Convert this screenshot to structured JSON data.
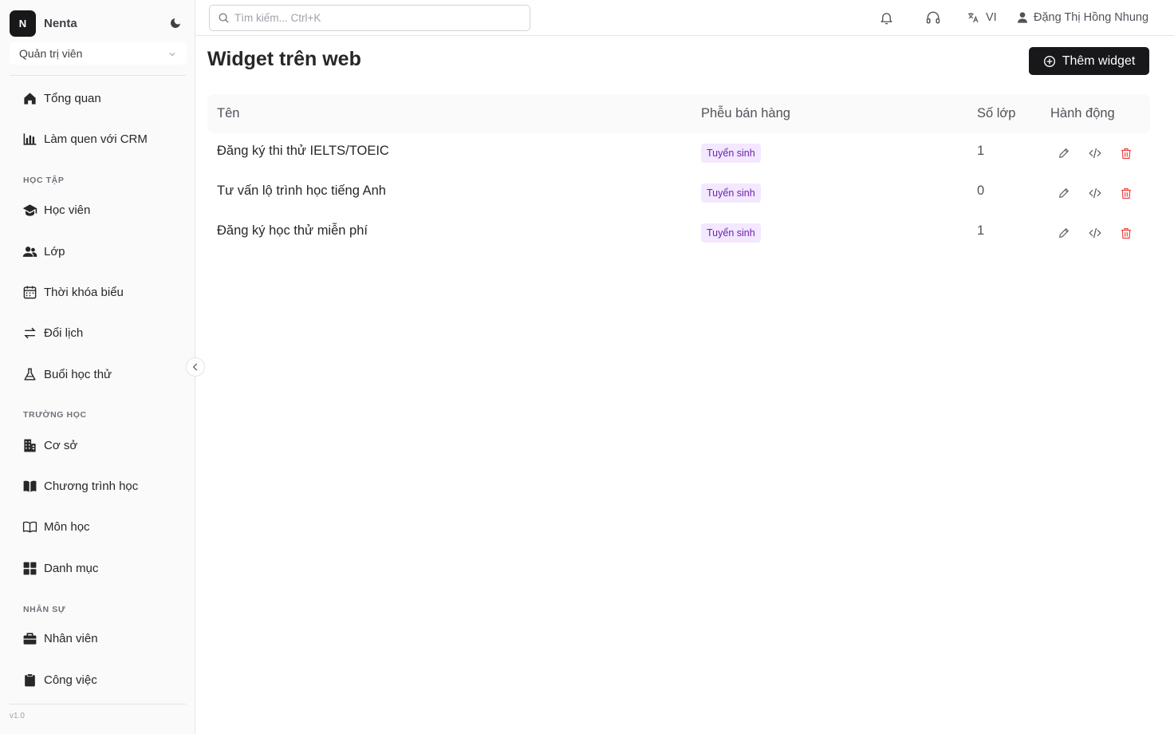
{
  "app": {
    "logo_letter": "N",
    "name": "Nenta"
  },
  "role": {
    "selected": "Quản trị viên"
  },
  "sidebar": {
    "items_top": [
      {
        "label": "Tổng quan",
        "icon": "home-icon"
      },
      {
        "label": "Làm quen với CRM",
        "icon": "bar-chart-icon"
      }
    ],
    "sections": [
      {
        "title": "HỌC TẬP",
        "items": [
          {
            "label": "Học viên",
            "icon": "graduation-cap-icon"
          },
          {
            "label": "Lớp",
            "icon": "users-icon"
          },
          {
            "label": "Thời khóa biểu",
            "icon": "calendar-icon"
          },
          {
            "label": "Đổi lịch",
            "icon": "swap-arrows-icon"
          },
          {
            "label": "Buổi học thử",
            "icon": "flask-icon"
          }
        ]
      },
      {
        "title": "TRƯỜNG HỌC",
        "items": [
          {
            "label": "Cơ sở",
            "icon": "building-icon"
          },
          {
            "label": "Chương trình học",
            "icon": "book-filled-icon"
          },
          {
            "label": "Môn học",
            "icon": "book-open-icon"
          },
          {
            "label": "Danh mục",
            "icon": "grid-icon"
          }
        ]
      },
      {
        "title": "NHÂN SỰ",
        "items": [
          {
            "label": "Nhân viên",
            "icon": "briefcase-icon"
          },
          {
            "label": "Công việc",
            "icon": "clipboard-icon"
          }
        ]
      }
    ],
    "version": "v1.0"
  },
  "header": {
    "search_placeholder": "Tìm kiếm... Ctrl+K",
    "language": "VI",
    "user_name": "Đặng Thị Hồng Nhung"
  },
  "page": {
    "title": "Widget trên web",
    "add_button": "Thêm widget"
  },
  "table": {
    "columns": [
      "Tên",
      "Phễu bán hàng",
      "Số lớp",
      "Hành động"
    ],
    "rows": [
      {
        "name": "Đăng ký thi thử IELTS/TOEIC",
        "funnel": "Tuyển sinh",
        "classes": "1"
      },
      {
        "name": "Tư vấn lộ trình học tiếng Anh",
        "funnel": "Tuyển sinh",
        "classes": "0"
      },
      {
        "name": "Đăng ký học thử miễn phí",
        "funnel": "Tuyển sinh",
        "classes": "1"
      }
    ]
  },
  "colors": {
    "primary_button": "#18181b",
    "badge_bg": "#f3e8ff",
    "badge_text": "#6b21a8",
    "delete": "#ef4444"
  }
}
